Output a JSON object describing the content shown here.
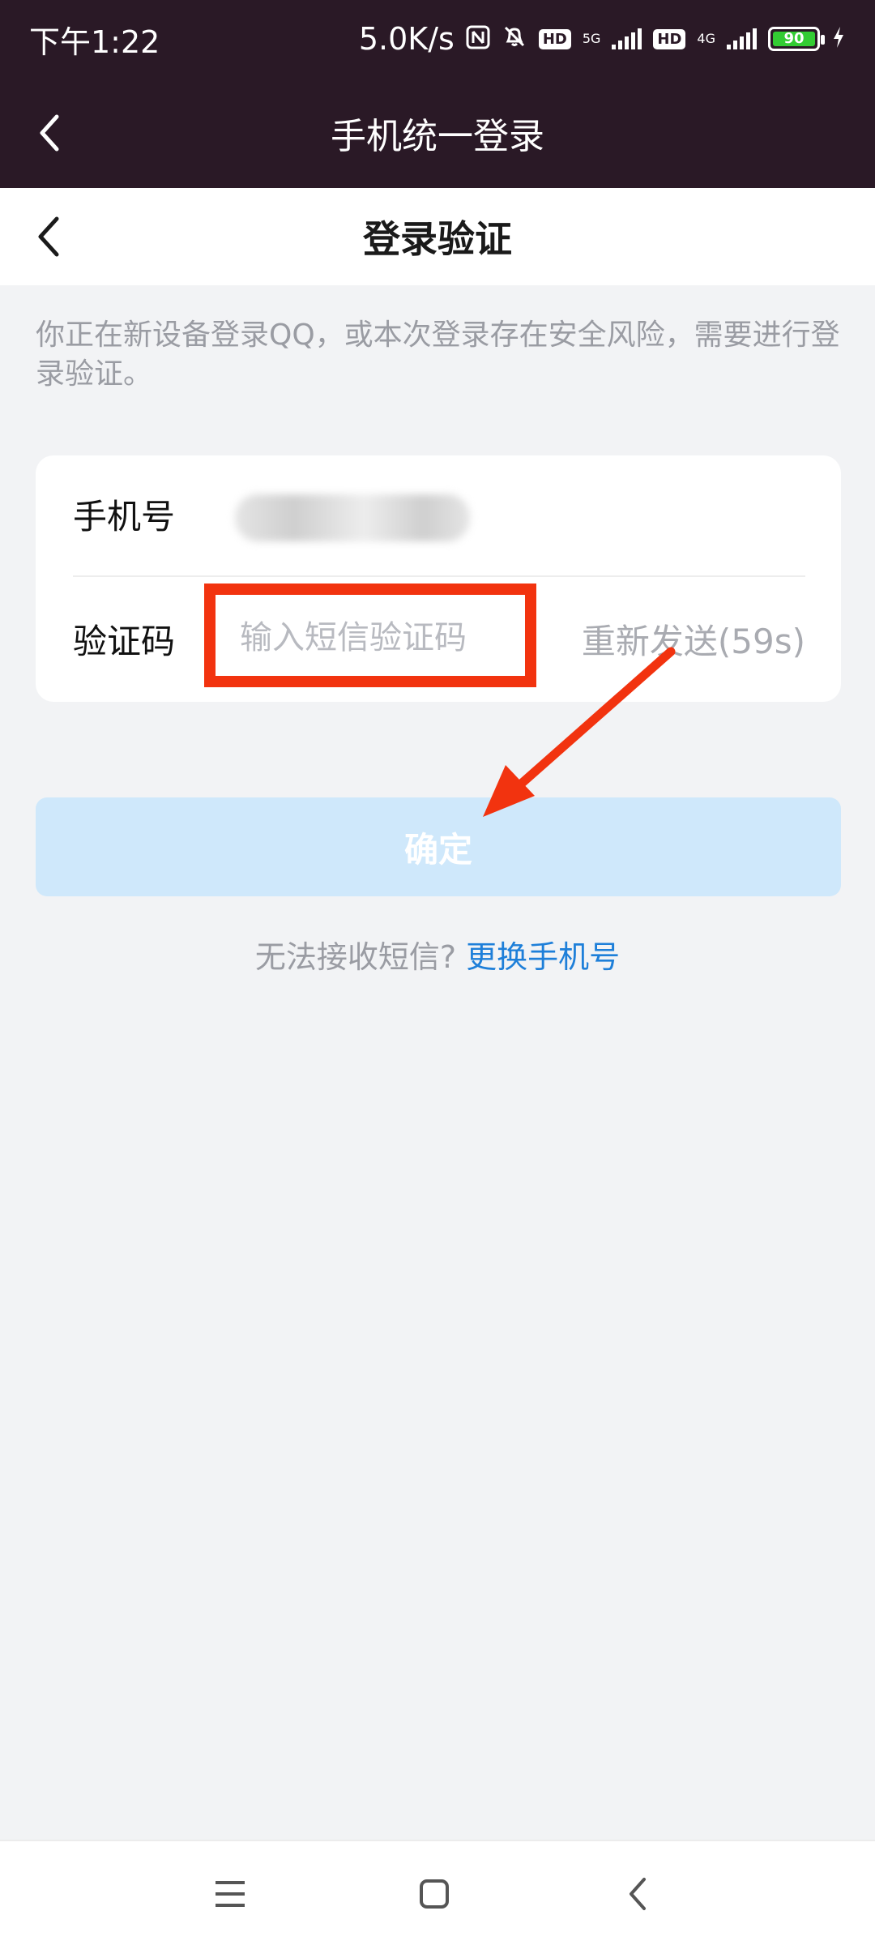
{
  "status_bar": {
    "time": "下午1:22",
    "net_speed": "5.0K/s",
    "hd1": "HD",
    "network1": "5G",
    "hd2": "HD",
    "network2": "4G",
    "battery": "90"
  },
  "app_bar": {
    "title": "手机统一登录"
  },
  "header": {
    "title": "登录验证"
  },
  "notice": "你正在新设备登录QQ，或本次登录存在安全风险，需要进行登录验证。",
  "form": {
    "phone_label": "手机号",
    "code_label": "验证码",
    "code_placeholder": "输入短信验证码",
    "resend_label": "重新发送(59s)"
  },
  "confirm_label": "确定",
  "help": {
    "question": "无法接收短信?",
    "link": "更换手机号"
  },
  "colors": {
    "status_bg": "#2a1926",
    "accent_link": "#1e7fd9",
    "confirm_disabled": "#cfe8fb",
    "annotation_red": "#f2330f"
  }
}
